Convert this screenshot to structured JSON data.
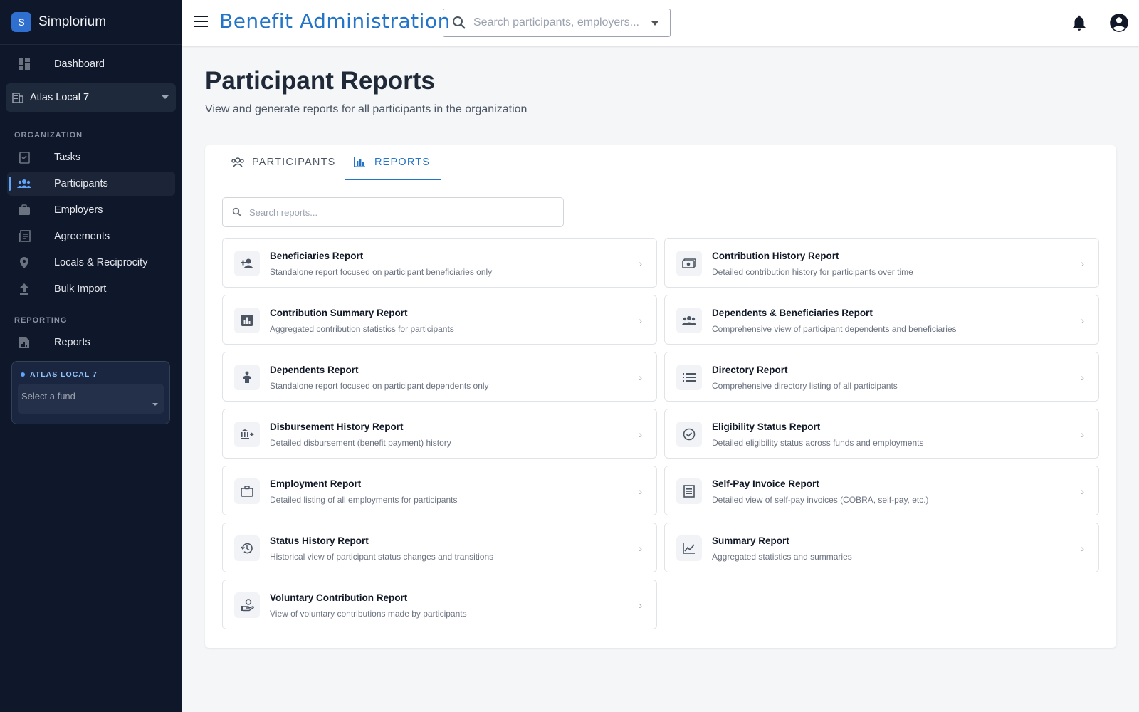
{
  "sidebar": {
    "brand_letter": "S",
    "brand_name": "Simplorium",
    "dashboard": "Dashboard",
    "org_selector": "Atlas Local 7",
    "section_org": "ORGANIZATION",
    "items_org": [
      "Tasks",
      "Participants",
      "Employers",
      "Agreements",
      "Locals & Reciprocity",
      "Bulk Import"
    ],
    "section_reporting": "REPORTING",
    "reports": "Reports",
    "fund_box_title": "ATLAS LOCAL 7",
    "fund_placeholder": "Select a fund"
  },
  "header": {
    "title": "Benefit Administration",
    "search_placeholder": "Search participants, employers..."
  },
  "page": {
    "title": "Participant Reports",
    "subtitle": "View and generate reports for all participants in the organization"
  },
  "tabs": [
    "PARTICIPANTS",
    "REPORTS"
  ],
  "report_search_placeholder": "Search reports...",
  "reports": [
    {
      "title": "Beneficiaries Report",
      "desc": "Standalone report focused on participant beneficiaries only",
      "icon": "person-add-icon"
    },
    {
      "title": "Contribution History Report",
      "desc": "Detailed contribution history for participants over time",
      "icon": "money-icon"
    },
    {
      "title": "Contribution Summary Report",
      "desc": "Aggregated contribution statistics for participants",
      "icon": "bar-chart-box-icon"
    },
    {
      "title": "Dependents & Beneficiaries Report",
      "desc": "Comprehensive view of participant dependents and beneficiaries",
      "icon": "group-icon"
    },
    {
      "title": "Dependents Report",
      "desc": "Standalone report focused on participant dependents only",
      "icon": "child-icon"
    },
    {
      "title": "Directory Report",
      "desc": "Comprehensive directory listing of all participants",
      "icon": "list-icon"
    },
    {
      "title": "Disbursement History Report",
      "desc": "Detailed disbursement (benefit payment) history",
      "icon": "bank-transfer-icon"
    },
    {
      "title": "Eligibility Status Report",
      "desc": "Detailed eligibility status across funds and employments",
      "icon": "check-circle-icon"
    },
    {
      "title": "Employment Report",
      "desc": "Detailed listing of all employments for participants",
      "icon": "briefcase-icon"
    },
    {
      "title": "Self-Pay Invoice Report",
      "desc": "Detailed view of self-pay invoices (COBRA, self-pay, etc.)",
      "icon": "invoice-icon"
    },
    {
      "title": "Status History Report",
      "desc": "Historical view of participant status changes and transitions",
      "icon": "history-icon"
    },
    {
      "title": "Summary Report",
      "desc": "Aggregated statistics and summaries",
      "icon": "line-chart-icon"
    },
    {
      "title": "Voluntary Contribution Report",
      "desc": "View of voluntary contributions made by participants",
      "icon": "hand-coin-icon"
    }
  ]
}
